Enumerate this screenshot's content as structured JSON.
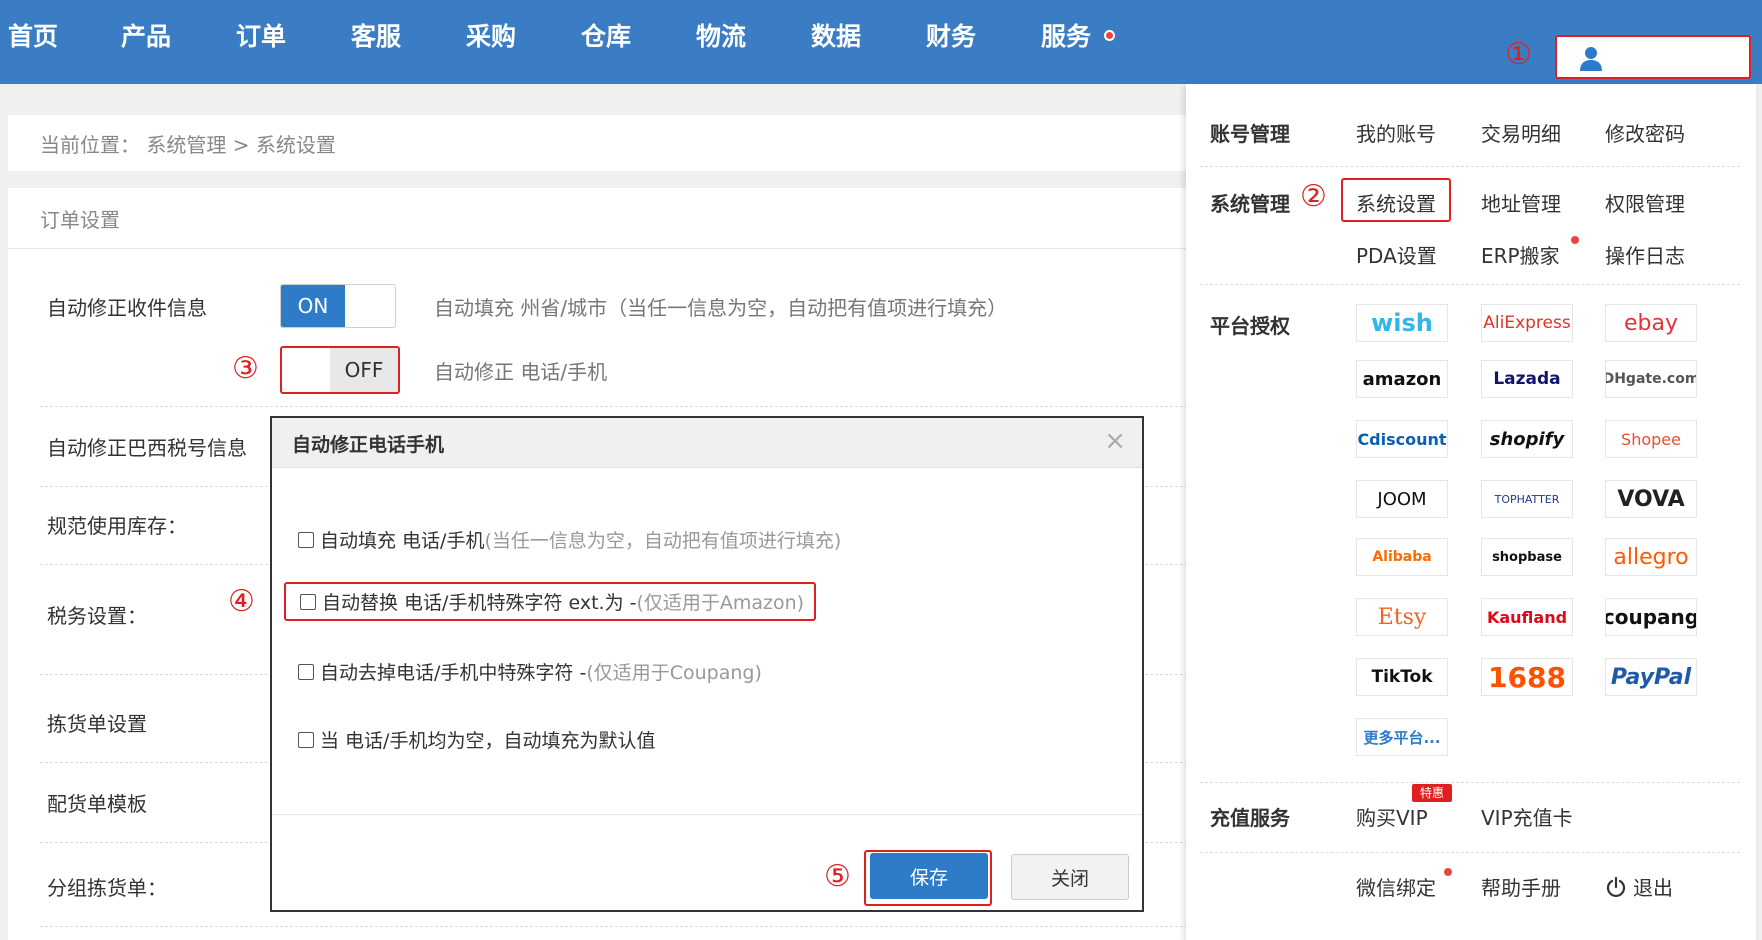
{
  "nav": {
    "items": [
      "首页",
      "产品",
      "订单",
      "客服",
      "采购",
      "仓库",
      "物流",
      "数据",
      "财务",
      "服务"
    ]
  },
  "markers": [
    "①",
    "②",
    "③",
    "④",
    "⑤"
  ],
  "breadcrumb": "当前位置：  系统管理 > 系统设置",
  "section": {
    "title": "订单设置",
    "rows": [
      {
        "label": "自动修正收件信息",
        "toggle": "ON",
        "desc": "自动填充 州省/城市（当任一信息为空，自动把有值项进行填充）"
      },
      {
        "toggle": "OFF",
        "desc": "自动修正 电话/手机"
      },
      {
        "label": "自动修正巴西税号信息"
      },
      {
        "label": "规范使用库存："
      },
      {
        "label": "税务设置："
      },
      {
        "label": "拣货单设置"
      },
      {
        "label": "配货单模板"
      },
      {
        "label": "分组拣货单："
      }
    ]
  },
  "modal": {
    "title": "自动修正电话手机",
    "close": "×",
    "options": [
      {
        "text": "自动填充 电话/手机",
        "hint": "(当任一信息为空，自动把有值项进行填充)"
      },
      {
        "text": "自动替换 电话/手机特殊字符 ext.为 - ",
        "hint": "(仅适用于Amazon)"
      },
      {
        "text": "自动去掉电话/手机中特殊字符 - ",
        "hint": "(仅适用于Coupang)"
      },
      {
        "text": "当 电话/手机均为空，自动填充为默认值",
        "hint": ""
      }
    ],
    "save": "保存",
    "close_btn": "关闭"
  },
  "dropdown": {
    "account": {
      "cat": "账号管理",
      "links": [
        "我的账号",
        "交易明细",
        "修改密码"
      ]
    },
    "system": {
      "cat": "系统管理",
      "links": [
        "系统设置",
        "地址管理",
        "权限管理",
        "PDA设置",
        "ERP搬家",
        "操作日志"
      ]
    },
    "platform": {
      "cat": "平台授权",
      "logos": [
        "wish",
        "AliExpress",
        "ebay",
        "amazon",
        "Lazada",
        "DHgate.com",
        "Cdiscount",
        "shopify",
        "Shopee",
        "JOOM",
        "TOPHATTER",
        "VOVA",
        "Alibaba",
        "shopbase",
        "allegro",
        "Etsy",
        "Kaufland",
        "coupang",
        "TikTok",
        "1688",
        "PayPal",
        "更多平台..."
      ]
    },
    "recharge": {
      "cat": "充值服务",
      "links": [
        "购买VIP",
        "VIP充值卡"
      ],
      "badge": "特惠"
    },
    "footer": [
      "微信绑定",
      "帮助手册",
      "退出"
    ]
  },
  "colors": {
    "nav": "#3a7dc5",
    "accent": "#2e7cc8",
    "marker": "#e02020"
  }
}
